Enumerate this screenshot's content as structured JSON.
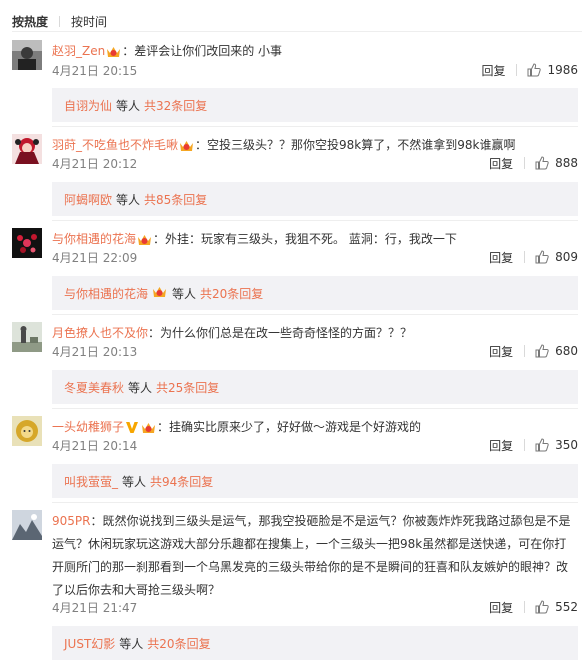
{
  "sort": {
    "hot": "按热度",
    "time": "按时间"
  },
  "etc_label": "等人",
  "reply_label": "回复",
  "comments": [
    {
      "user": "赵羽_Zen",
      "separator": "：",
      "content": "差评会让你们改回来的 小事",
      "time": "4月21日 20:15",
      "likes": "1986",
      "sub_user": "自诩为仙",
      "sub_count": "共32条回复"
    },
    {
      "user": "羽莳_不吃鱼也不炸毛啾",
      "separator": "：",
      "content": "空投三级头？？那你空投98k算了，不然谁拿到98k谁赢啊",
      "time": "4月21日 20:12",
      "likes": "888",
      "sub_user": "阿蝎啊欧",
      "sub_count": "共85条回复"
    },
    {
      "user": "与你相遇的花海",
      "separator": "：",
      "content": "外挂：玩家有三级头，我狙不死。 蓝洞：行，我改一下",
      "time": "4月21日 22:09",
      "likes": "809",
      "sub_user": "与你相遇的花海",
      "sub_count": "共20条回复"
    },
    {
      "user": "月色撩人也不及你",
      "separator": "：",
      "content": "为什么你们总是在改一些奇奇怪怪的方面？？？",
      "time": "4月21日 20:13",
      "likes": "680",
      "sub_user": "冬夏美春秋",
      "sub_count": "共25条回复"
    },
    {
      "user": "一头幼稚狮子",
      "separator": "：",
      "content": "挂确实比原来少了，好好做～游戏是个好游戏的",
      "time": "4月21日 20:14",
      "likes": "350",
      "sub_user": "叫我萤萤_",
      "sub_count": "共94条回复"
    },
    {
      "user": "905PR",
      "separator": "：",
      "content": "既然你说找到三级头是运气，那我空投砸脸是不是运气？你被轰炸炸死我路过舔包是不是运气？休闲玩家玩这游戏大部分乐趣都在搜集上，一个三级头一把98k虽然都是送快递，可在你打开厕所门的那一刹那看到一个乌黑发亮的三级头带给你的是不是瞬间的狂喜和队友嫉妒的眼神？改了以后你去和大哥抢三级头啊？",
      "time": "4月21日 21:47",
      "likes": "552",
      "sub_user": "JUST幻影",
      "sub_count": "共20条回复"
    }
  ],
  "colors": {
    "username": "#eb7350",
    "text": "#333333",
    "meta": "#808080",
    "sub_bg": "#f2f2f5",
    "divider": "#eeeeee"
  }
}
